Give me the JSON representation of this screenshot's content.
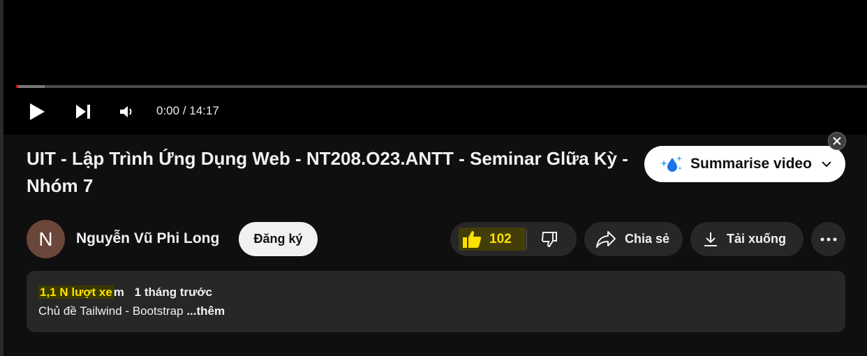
{
  "player": {
    "time_current": "0:00",
    "time_separator": " / ",
    "time_total": "14:17",
    "progress_fraction": 0.002,
    "buffered_fraction": 0.034,
    "controls": {
      "play_icon": "play-icon",
      "next_icon": "skip-next-icon",
      "volume_icon": "volume-icon"
    }
  },
  "video": {
    "title": "UIT - Lập Trình Ứng Dụng Web - NT208.O23.ANTT - Seminar Glữa Kỳ - Nhóm 7"
  },
  "summarise": {
    "label": "Summarise video",
    "icon": "sparkle-droplet-icon",
    "chevron_icon": "chevron-down-icon",
    "close_icon": "close-icon"
  },
  "channel": {
    "avatar_letter": "N",
    "avatar_color": "#6b463b",
    "name": "Nguyễn Vũ Phi Long",
    "subscribe_label": "Đăng ký"
  },
  "actions": {
    "like_count": "102",
    "like_icon": "thumbs-up-icon",
    "dislike_icon": "thumbs-down-icon",
    "share_label": "Chia sẻ",
    "share_icon": "share-icon",
    "download_label": "Tải xuống",
    "download_icon": "download-icon",
    "more_icon": "more-horizontal-icon"
  },
  "description": {
    "views_highlighted": "1,1 N lượt xe",
    "views_rest": "m",
    "date": "1 tháng trước",
    "text": "Chủ đề Tailwind - Bootstrap ",
    "more_label": "...thêm"
  },
  "colors": {
    "background": "#0f0f0f",
    "surface": "#272727",
    "highlight_yellow": "#ffe100",
    "progress_red": "#ff0000"
  }
}
